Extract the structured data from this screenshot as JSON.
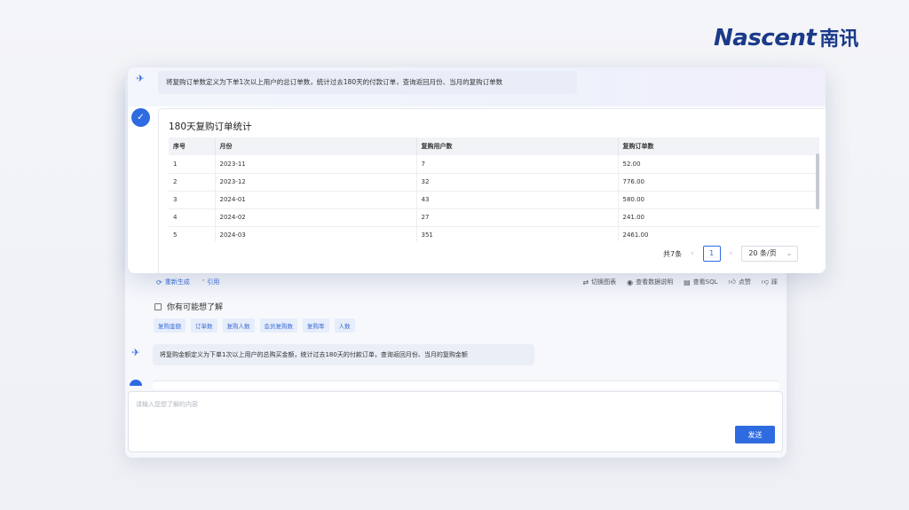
{
  "logo": {
    "en_bold": "Na",
    "en_rest": "scent",
    "cn": "南讯"
  },
  "question1": "将复购订单数定义为下单1次以上用户的总订单数，统计过去180天的付款订单，查询返回月份、当月的复购订单数",
  "result": {
    "title": "180天复购订单统计",
    "columns": [
      "序号",
      "月份",
      "复购用户数",
      "复购订单数"
    ],
    "rows": [
      [
        "1",
        "2023-11",
        "7",
        "52.00"
      ],
      [
        "2",
        "2023-12",
        "32",
        "776.00"
      ],
      [
        "3",
        "2024-01",
        "43",
        "580.00"
      ],
      [
        "4",
        "2024-02",
        "27",
        "241.00"
      ],
      [
        "5",
        "2024-03",
        "351",
        "2461.00"
      ]
    ],
    "pager": {
      "total": "共7条",
      "prev": "‹",
      "page": "1",
      "next": "›",
      "page_size": "20 条/页",
      "chevron": "⌄"
    }
  },
  "feedback": {
    "regenerate": "重新生成",
    "quote": "引用",
    "switch_chart": "切换图表",
    "view_data_desc": "查看数据说明",
    "view_sql": "查看SQL",
    "like": "点赞",
    "dislike": "踩"
  },
  "suggestions": {
    "title": "你有可能想了解",
    "tags": [
      "复购金额",
      "订单数",
      "复购人数",
      "会员复购数",
      "复购率",
      "人数"
    ]
  },
  "question2": "将复购金额定义为下单1次以上用户的总购买金额，统计过去180天的付款订单，查询返回月份、当月的复购金额",
  "input": {
    "placeholder": "请输入您想了解的内容",
    "value": ""
  },
  "send_label": "发送",
  "colors": {
    "accent": "#2f6be0",
    "brand": "#1a3a8a"
  },
  "icons": {
    "send_plane": "send-plane-icon",
    "bot": "bot-avatar-icon",
    "regenerate": "refresh-icon",
    "quote": "quote-icon",
    "chart": "chart-icon",
    "eye": "eye-icon",
    "sql": "database-icon",
    "like": "thumbs-up-icon",
    "dislike": "thumbs-down-icon",
    "suggest": "lightbulb-icon"
  }
}
